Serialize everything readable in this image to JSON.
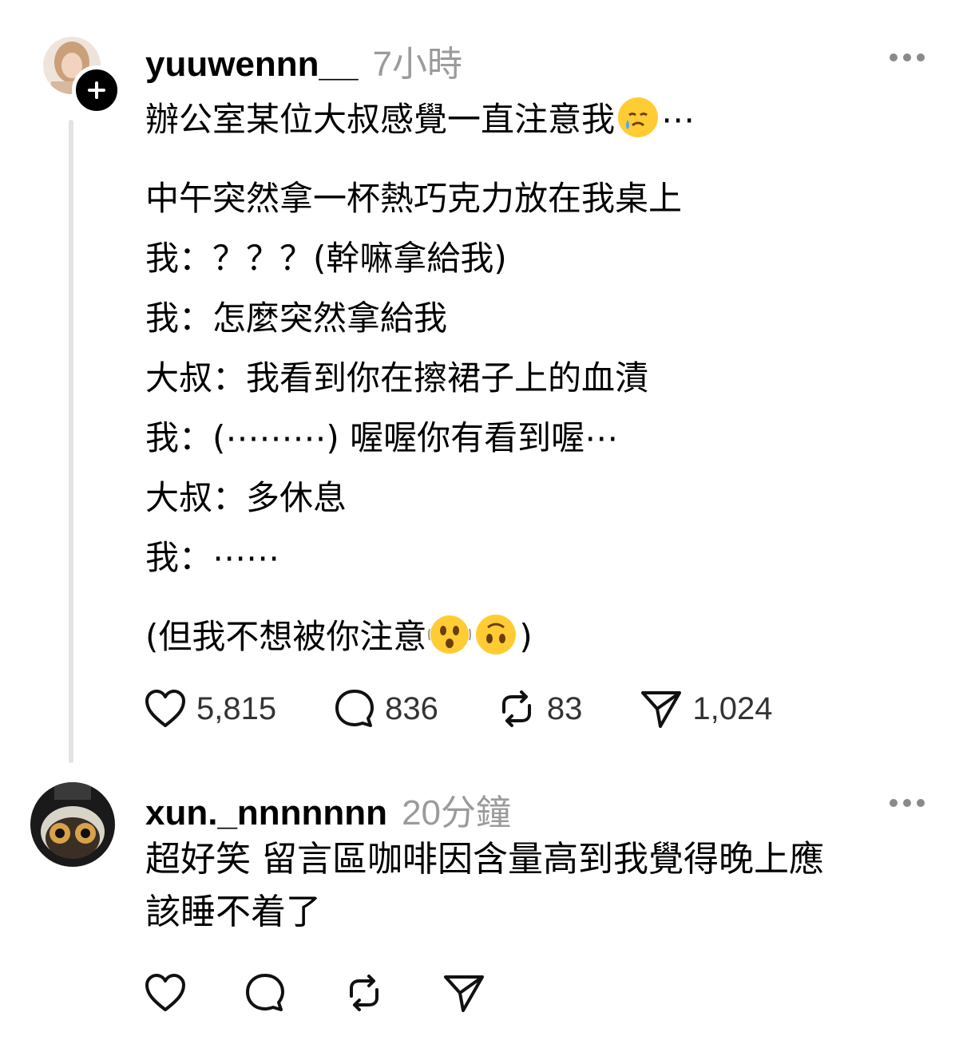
{
  "post": {
    "username": "yuuwennn__",
    "time": "7小時",
    "text_lines_1": [
      "辦公室某位大叔感覺一直注意我"
    ],
    "text_lines_1_suffix": "⋯",
    "text_lines_2": [
      "中午突然拿一杯熱巧克力放在我桌上",
      "我：？？？(幹嘛拿給我)",
      "我：怎麼突然拿給我",
      "大叔：我看到你在擦裙子上的血漬",
      "我：(⋯⋯⋯) 喔喔你有看到喔⋯",
      "大叔：多休息",
      "我：⋯⋯"
    ],
    "text_line_3_prefix": "(但我不想被你注意",
    "text_line_3_suffix": ")",
    "likes": "5,815",
    "comments": "836",
    "reposts": "83",
    "shares": "1,024"
  },
  "reply": {
    "username": "xun._nnnnnnn",
    "time": "20分鐘",
    "text_lines": [
      "超好笑 留言區咖啡因含量高到我覺得晚上應",
      "該睡不着了"
    ]
  },
  "icons": [
    "heart-icon",
    "comment-icon",
    "repost-icon",
    "share-icon",
    "more-icon",
    "follow-plus-icon"
  ],
  "colors": {
    "text": "#000000",
    "muted": "#9b9b9b",
    "thread_line": "#e3e3e3"
  }
}
